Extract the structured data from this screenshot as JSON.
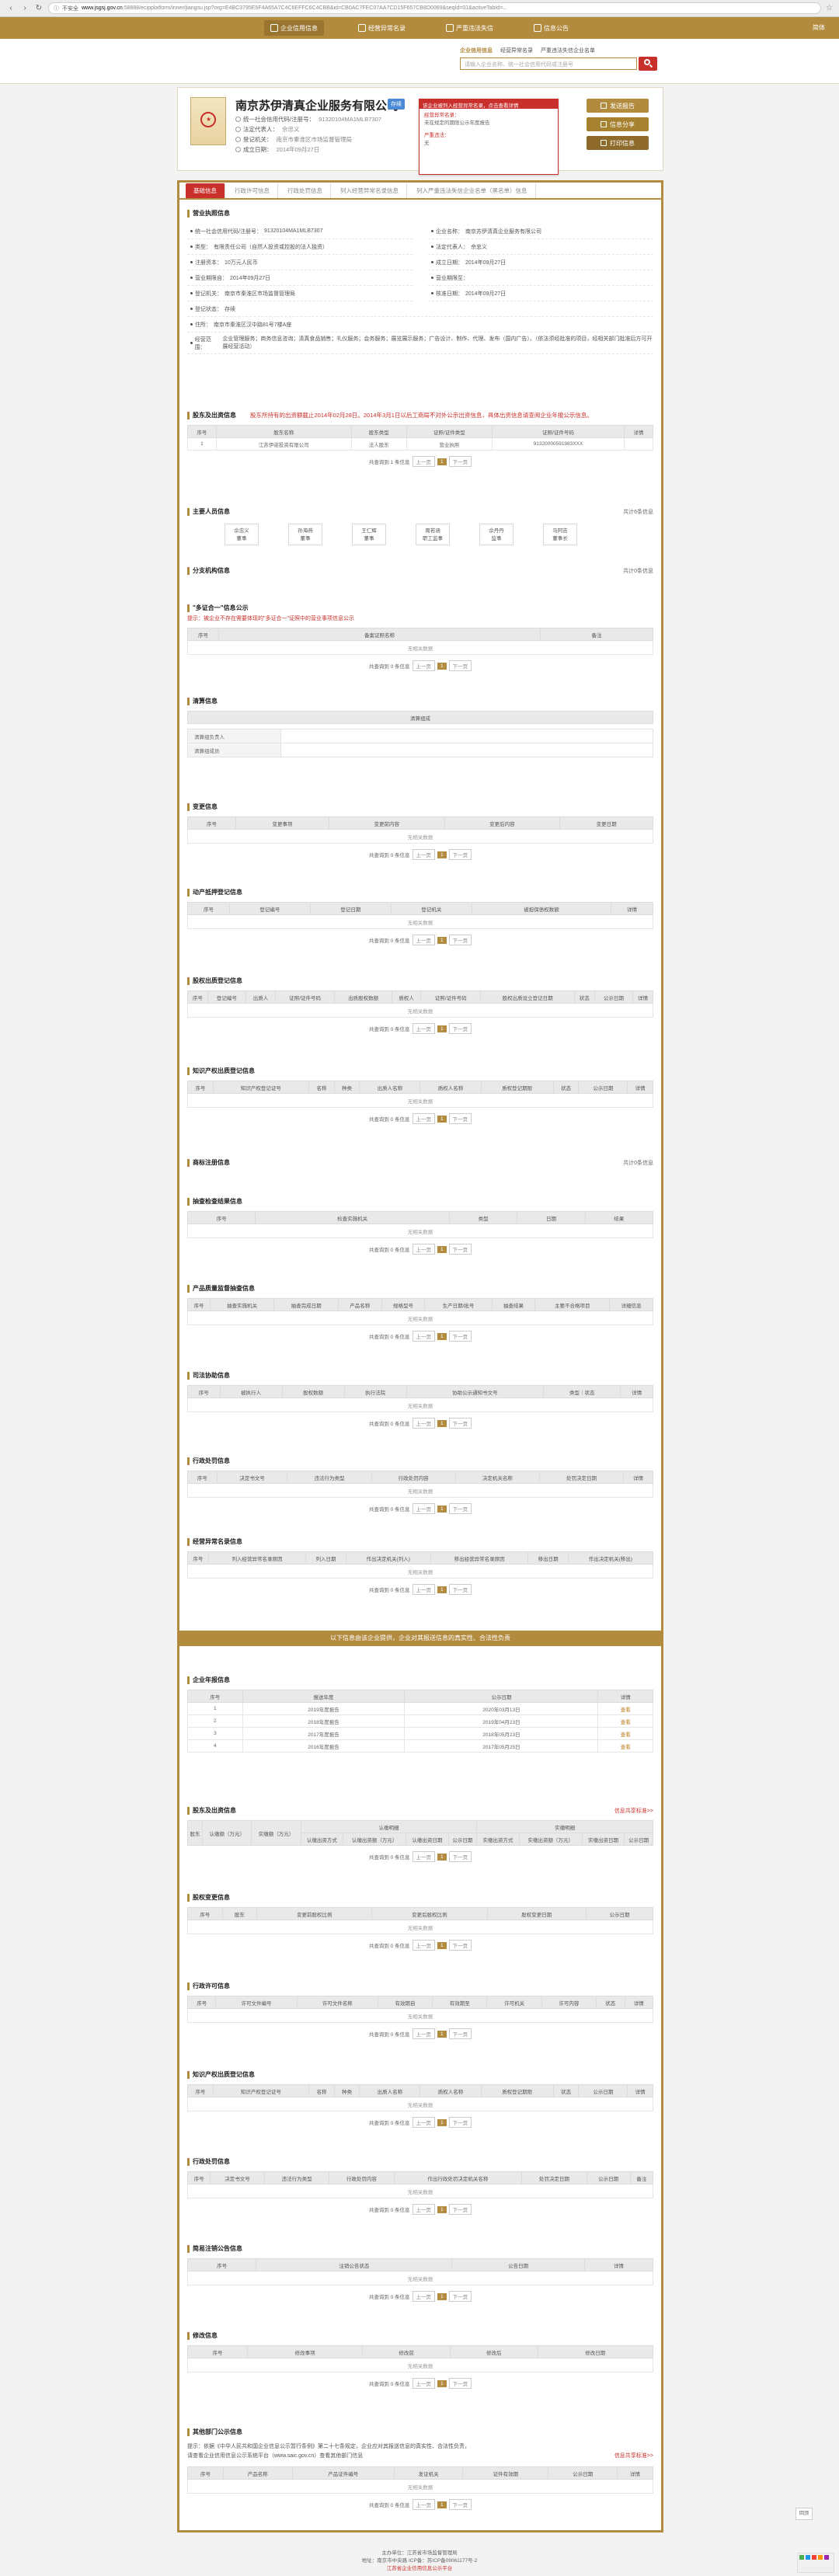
{
  "browser": {
    "prefix": "不安全",
    "host": "www.jsgsj.gov.cn",
    "path": ":58888/ecipplatform/inner/jiangsu.jsp?org=E4BC3795E5F4A65A7C4C6EFFC6C4CBB&id=CB0AC7FEC07AA7CD15F657CB8D0069&seqId=01&activeTabId=..."
  },
  "site_nav": {
    "items": [
      {
        "label": "企业信用信息"
      },
      {
        "label": "经营异常名录"
      },
      {
        "label": "严重违法失信"
      },
      {
        "label": "信息公告"
      }
    ],
    "right_text": "简体"
  },
  "search": {
    "tabs": [
      "企业信用信息",
      "经营异常名录",
      "严重违法失信企业名单"
    ],
    "placeholder": "请输入企业名称、统一社会信用代码或注册号"
  },
  "company": {
    "name": "南京苏伊清真企业服务有限公司",
    "status": "存续",
    "rows": [
      {
        "label": "统一社会信用代码/注册号：",
        "value": "91320104MA1MLB7307"
      },
      {
        "label": "法定代表人：",
        "value": "佘忠义"
      },
      {
        "label": "登记机关：",
        "value": "南京市秦淮区市场监督管理局"
      },
      {
        "label": "成立日期：",
        "value": "2014年09月27日"
      }
    ],
    "popup": {
      "head": "该企业被列入经营异常名录，点击查看详情",
      "line1": "经营异常名录：",
      "line2": "未在规定的期限公示年度报告",
      "line3": "严重违法：",
      "line4": "无"
    },
    "actions": [
      "发送报告",
      "信息分享",
      "打印信息"
    ]
  },
  "tabs": [
    "基础信息",
    "行政许可信息",
    "行政处罚信息",
    "列入经营异常名录信息",
    "列入严重违法失信企业名单（黑名单）信息"
  ],
  "basic": {
    "title": "营业执照信息",
    "fields": [
      {
        "label": "统一社会信用代码/注册号：",
        "value": "91320104MA1MLB7307"
      },
      {
        "label": "企业名称：",
        "value": "南京苏伊清真企业服务有限公司"
      },
      {
        "label": "类型：",
        "value": "有限责任公司（自然人投资或控股的法人独资）"
      },
      {
        "label": "法定代表人：",
        "value": "佘忠义"
      },
      {
        "label": "注册资本：",
        "value": "10万元人民币"
      },
      {
        "label": "成立日期：",
        "value": "2014年09月27日"
      },
      {
        "label": "营业期限自：",
        "value": "2014年09月27日"
      },
      {
        "label": "营业期限至：",
        "value": ""
      },
      {
        "label": "登记机关：",
        "value": "南京市秦淮区市场监督管理局"
      },
      {
        "label": "核准日期：",
        "value": "2014年09月27日"
      },
      {
        "label": "登记状态：",
        "value": "存续"
      }
    ],
    "address": {
      "label": "住所：",
      "value": "南京市秦淮区汉中路81号7楼A座"
    },
    "scope": {
      "label": "经营范围：",
      "value": "企业管理服务；商务信息咨询；清真食品销售；礼仪服务；会务服务；展览展示服务；广告设计、制作、代理、发布（国内广告）。（依法须经批准的项目，经相关部门批准后方可开展经营活动）"
    }
  },
  "shareholders": {
    "title": "股东及出资信息",
    "note": "股东所持有的出资额截止2014年02月28日。2014年3月1日以后工商局不对外公示出资信息，具体出资信息请查阅企业年报公示信息。",
    "headers": [
      "序号",
      "股东名称",
      "股东类型",
      "证照/证件类型",
      "证照/证件号码",
      "详情"
    ],
    "rows": [
      [
        "1",
        "江苏伊诺投资有限公司",
        "法人股东",
        "营业执照",
        "91320000591983XXX",
        ""
      ]
    ],
    "pager": {
      "total": "共查询到 1 条信息",
      "prev": "上一页",
      "page": "1",
      "next": "下一页"
    }
  },
  "members": {
    "title": "主要人员信息",
    "right": "共计6条信息",
    "people": [
      {
        "name": "佘忠义",
        "role": "董事"
      },
      {
        "name": "孙海燕",
        "role": "董事"
      },
      {
        "name": "王仁辉",
        "role": "董事"
      },
      {
        "name": "周若涵",
        "role": "职工监事"
      },
      {
        "name": "佘丹丹",
        "role": "监事"
      },
      {
        "name": "马阿吉",
        "role": "董事长"
      }
    ]
  },
  "branches": {
    "title": "分支机构信息",
    "right": "共计0条信息"
  },
  "multi": {
    "title": "\"多证合一\"信息公示",
    "note": "提示：被企业不存在需要体现的\"多证合一\"证照中的营业事项信息公示",
    "headers": [
      "序号",
      "备案证照名称",
      "备注"
    ],
    "empty": "无相关数据",
    "pager": {
      "total": "共查询到 0 条信息",
      "prev": "上一页",
      "page": "1",
      "next": "下一页"
    }
  },
  "liquidation": {
    "title": "清算信息",
    "header": "清算组成",
    "rows": [
      [
        "清算组负责人",
        ""
      ],
      [
        "清算组成员",
        ""
      ]
    ]
  },
  "changes": {
    "title": "变更信息",
    "headers": [
      "序号",
      "变更事项",
      "变更前内容",
      "变更后内容",
      "变更日期"
    ],
    "empty": "无相关数据",
    "pager": {
      "total": "共查询到 0 条信息",
      "prev": "上一页",
      "page": "1",
      "next": "下一页"
    }
  },
  "pledge": {
    "title": "动产抵押登记信息",
    "headers": [
      "序号",
      "登记编号",
      "登记日期",
      "登记机关",
      "被担保债权数额",
      "详情"
    ],
    "empty": "无相关数据",
    "pager": {
      "total": "共查询到 0 条信息",
      "prev": "上一页",
      "page": "1",
      "next": "下一页"
    }
  },
  "equity": {
    "title": "股权出质登记信息",
    "headers": [
      "序号",
      "登记编号",
      "出质人",
      "证照/证件号码",
      "出质股权数额",
      "质权人",
      "证照/证件号码",
      "股权出质设立登记日期",
      "状态",
      "公示日期",
      "详情"
    ],
    "empty": "无相关数据",
    "pager": {
      "total": "共查询到 0 条信息",
      "prev": "上一页",
      "page": "1",
      "next": "下一页"
    }
  },
  "ip_pledge": {
    "title": "知识产权出质登记信息",
    "headers": [
      "序号",
      "知识产权登记证号",
      "名称",
      "种类",
      "出质人名称",
      "质权人名称",
      "质权登记期限",
      "状态",
      "公示日期",
      "详情"
    ],
    "empty": "无相关数据",
    "pager": {
      "total": "共查询到 0 条信息",
      "prev": "上一页",
      "page": "1",
      "next": "下一页"
    }
  },
  "trademark": {
    "title": "商标注册信息",
    "right": "共计0条信息"
  },
  "inspect": {
    "title": "抽查检查结果信息",
    "headers": [
      "序号",
      "检查实施机关",
      "类型",
      "日期",
      "结果"
    ],
    "empty": "无相关数据",
    "pager": {
      "total": "共查询到 0 条信息",
      "prev": "上一页",
      "page": "1",
      "next": "下一页"
    }
  },
  "product": {
    "title": "产品质量监督抽查信息",
    "headers": [
      "序号",
      "抽查实施机关",
      "抽查完成日期",
      "产品名称",
      "规格型号",
      "生产日期/批号",
      "抽查结果",
      "主要不合格项目",
      "详细信息"
    ],
    "empty": "无相关数据",
    "pager": {
      "total": "共查询到 0 条信息",
      "prev": "上一页",
      "page": "1",
      "next": "下一页"
    }
  },
  "court": {
    "title": "司法协助信息",
    "headers": [
      "序号",
      "被执行人",
      "股权数额",
      "执行法院",
      "协助公示通知书文号",
      "类型｜状态",
      "详情"
    ],
    "empty": "无相关数据",
    "pager": {
      "total": "共查询到 0 条信息",
      "prev": "上一页",
      "page": "1",
      "next": "下一页"
    }
  },
  "punish": {
    "title": "行政处罚信息",
    "headers": [
      "序号",
      "决定书文号",
      "违法行为类型",
      "行政处罚内容",
      "决定机关名称",
      "处罚决定日期",
      "详情"
    ],
    "empty": "无相关数据",
    "pager": {
      "total": "共查询到 0 条信息",
      "prev": "上一页",
      "page": "1",
      "next": "下一页"
    }
  },
  "abnormal": {
    "title": "经营异常名录信息",
    "headers": [
      "序号",
      "列入经营异常名录原因",
      "列入日期",
      "作出决定机关(列入)",
      "移出经营异常名录原因",
      "移出日期",
      "作出决定机关(移出)"
    ],
    "empty": "无相关数据",
    "pager": {
      "total": "共查询到 0 条信息",
      "prev": "上一页",
      "page": "1",
      "next": "下一页"
    }
  },
  "band": {
    "text": "以下信息由该企业提供，企业对其报送信息的真实性、合法性负责"
  },
  "annual": {
    "title": "企业年报信息",
    "headers": [
      "序号",
      "报送年度",
      "公示日期",
      "详情"
    ],
    "rows": [
      [
        "1",
        "2019年度报告",
        "2020年03月13日",
        "查看"
      ],
      [
        "2",
        "2018年度报告",
        "2019年04月23日",
        "查看"
      ],
      [
        "3",
        "2017年度报告",
        "2018年05月23日",
        "查看"
      ],
      [
        "4",
        "2016年度报告",
        "2017年05月25日",
        "查看"
      ]
    ]
  },
  "investment": {
    "title": "股东及出资信息",
    "right": "信息共享标准>>",
    "headers": [
      "股东",
      "认缴额（万元）",
      "实缴额（万元）",
      "认缴出资方式",
      "认缴出资额（万元）",
      "认缴出资日期",
      "公示日期",
      "实缴出资方式",
      "实缴出资额（万元）",
      "实缴出资日期",
      "公示日期"
    ],
    "group1": "认缴明细",
    "group2": "实缴明细",
    "pager": {
      "total": "共查询到 0 条信息",
      "prev": "上一页",
      "page": "1",
      "next": "下一页"
    }
  },
  "equity_change": {
    "title": "股权变更信息",
    "headers": [
      "序号",
      "股东",
      "变更前股权比例",
      "变更后股权比例",
      "股权变更日期",
      "公示日期"
    ],
    "empty": "无相关数据",
    "pager": {
      "total": "共查询到 0 条信息",
      "prev": "上一页",
      "page": "1",
      "next": "下一页"
    }
  },
  "license": {
    "title": "行政许可信息",
    "headers": [
      "序号",
      "许可文件编号",
      "许可文件名称",
      "有效期自",
      "有效期至",
      "许可机关",
      "许可内容",
      "状态",
      "详情"
    ],
    "empty": "无相关数据",
    "pager": {
      "total": "共查询到 0 条信息",
      "prev": "上一页",
      "page": "1",
      "next": "下一页"
    }
  },
  "ip_pledge2": {
    "title": "知识产权出质登记信息",
    "headers": [
      "序号",
      "知识产权登记证号",
      "名称",
      "种类",
      "出质人名称",
      "质权人名称",
      "质权登记期限",
      "状态",
      "公示日期",
      "详情"
    ],
    "empty": "无相关数据",
    "pager": {
      "total": "共查询到 0 条信息",
      "prev": "上一页",
      "page": "1",
      "next": "下一页"
    }
  },
  "punish2": {
    "title": "行政处罚信息",
    "headers": [
      "序号",
      "决定书文号",
      "违法行为类型",
      "行政处罚内容",
      "作出行政处罚决定机关名称",
      "处罚决定日期",
      "公示日期",
      "备注"
    ],
    "empty": "无相关数据",
    "pager": {
      "total": "共查询到 0 条信息",
      "prev": "上一页",
      "page": "1",
      "next": "下一页"
    }
  },
  "simple_cancel": {
    "title": "简易注销公告信息",
    "headers": [
      "序号",
      "注销公告状态",
      "公告日期",
      "详情"
    ],
    "empty": "无相关数据",
    "pager": {
      "total": "共查询到 0 条信息",
      "prev": "上一页",
      "page": "1",
      "next": "下一页"
    }
  },
  "prop": {
    "title": "修改信息",
    "headers": [
      "序号",
      "修改事项",
      "修改前",
      "修改后",
      "修改日期"
    ],
    "empty": "无相关数据",
    "pager": {
      "total": "共查询到 0 条信息",
      "prev": "上一页",
      "page": "1",
      "next": "下一页"
    }
  },
  "other": {
    "title": "其他部门公示信息",
    "note1": "提示：依据《中华人民共和国企业信息公示暂行条例》第二十七条规定，企业应对其报送信息的真实性、合法性负责，",
    "note2": "请查看企业信用信息公示系统平台（www.saic.gov.cn）查看其他部门信息",
    "right": "信息共享标准>>",
    "headers": [
      "序号",
      "产品名称",
      "产品证件编号",
      "发证机关",
      "证件有效期",
      "公示日期",
      "详情"
    ],
    "empty": "无相关数据",
    "pager": {
      "total": "共查询到 0 条信息",
      "prev": "上一页",
      "page": "1",
      "next": "下一页"
    }
  },
  "footer": {
    "line1": "主办单位：江苏省市场监督管理局",
    "line2": "地址：南京市中央路 ICP备：苏ICP备09061177号-2",
    "line3": "江苏省企业信用信息公示平台"
  },
  "side_float": "回顶"
}
